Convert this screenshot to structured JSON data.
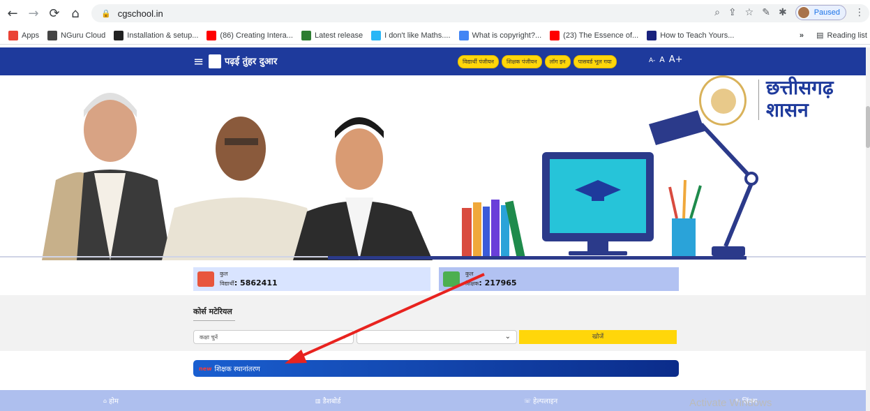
{
  "browser": {
    "url": "cgschool.in",
    "paused_label": "Paused",
    "bookmarks": [
      {
        "label": "Apps",
        "icon": "apps-grid-icon",
        "color": "#ea4335"
      },
      {
        "label": "NGuru Cloud",
        "icon": "globe-icon",
        "color": "#444444"
      },
      {
        "label": "Installation & setup...",
        "icon": "hp-icon",
        "color": "#222222"
      },
      {
        "label": "(86) Creating Intera...",
        "icon": "youtube-icon",
        "color": "#ff0000"
      },
      {
        "label": "Latest release",
        "icon": "release-icon",
        "color": "#2e7d32"
      },
      {
        "label": "I don't like Maths....",
        "icon": "cloud-icon",
        "color": "#29b6f6"
      },
      {
        "label": "What is copyright?...",
        "icon": "google-icon",
        "color": "#4285f4"
      },
      {
        "label": "(23) The Essence of...",
        "icon": "youtube-icon",
        "color": "#ff0000"
      },
      {
        "label": "How to Teach Yours...",
        "icon": "shy-icon",
        "color": "#1a237e"
      }
    ],
    "more_label": "»",
    "reading_list": "Reading list"
  },
  "header": {
    "title": "पढ़ई तुंहर दुआर",
    "buttons": [
      "विद्यार्थी पंजीयन",
      "शिक्षक पंजीयन",
      "लॉग इन",
      "पासवर्ड भूल गया"
    ],
    "font_small": "A-",
    "font_normal": "A",
    "font_large": "A+"
  },
  "brand": {
    "line1": "छत्तीसगढ़",
    "line2": "शासन"
  },
  "stats": {
    "students": {
      "label": "कुल",
      "sub": "विद्यार्थी",
      "value": ": 5862411"
    },
    "teachers": {
      "label": "कुल",
      "sub": "शिक्षक",
      "value": ": 217965"
    }
  },
  "course": {
    "title": "कोर्स मटेरियल",
    "class_placeholder": "कक्षा चुनें",
    "search_label": "खोजें"
  },
  "transfer": {
    "new_tag": "new",
    "label": "शिक्षक स्थानांतरण"
  },
  "bottom_nav": {
    "home": "होम",
    "dashboard": "डैशबोर्ड",
    "helpline": "हेल्पलाइन",
    "links": "लिंक्स"
  },
  "watermark": "Activate Windows",
  "colors": {
    "header_bg": "#1e3a9c",
    "button_yellow": "#ffd60a",
    "stat_student_bg": "#d9e4ff",
    "stat_teacher_bg": "#b2c2f2",
    "arrow_red": "#e8231f"
  }
}
